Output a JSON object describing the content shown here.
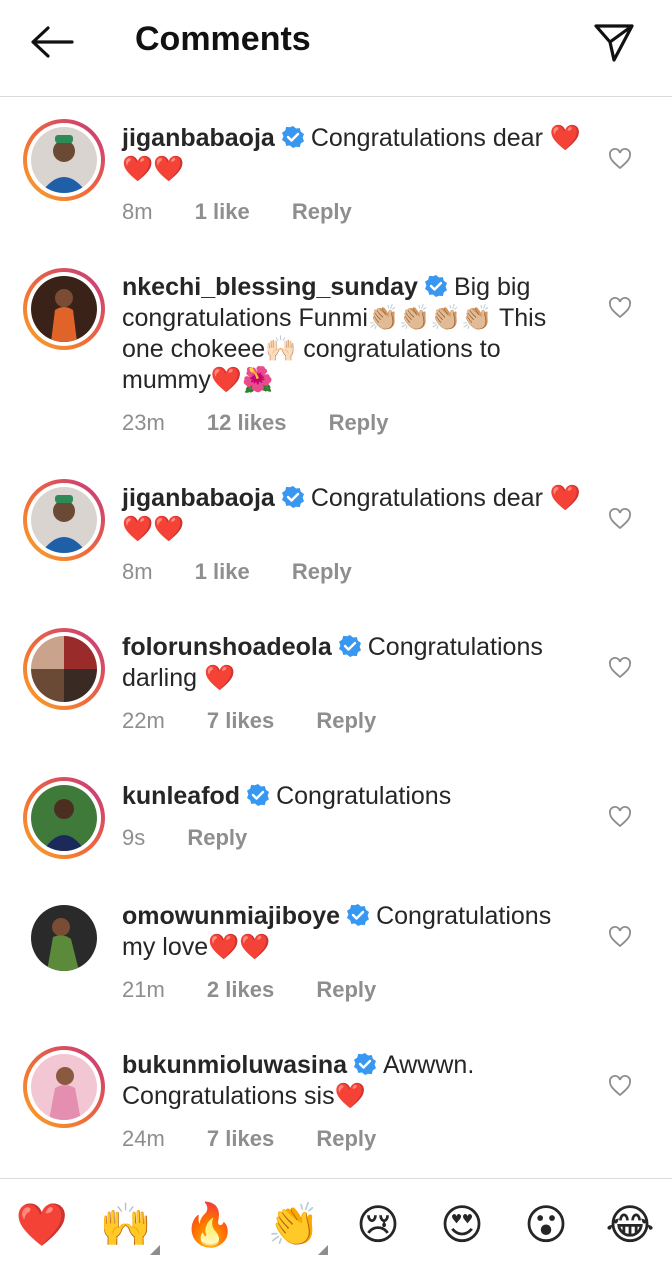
{
  "header": {
    "title": "Comments"
  },
  "comments": [
    {
      "username": "jiganbabaoja",
      "text": "Congratulations dear ❤️❤️❤️",
      "time": "8m",
      "likes": "1 like",
      "reply": "Reply",
      "avatar_ring": "gradient"
    },
    {
      "username": "nkechi_blessing_sunday",
      "text": "Big big congratulations Funmi👏🏼👏🏼👏🏼👏🏼 This one chokeee🙌🏻 congratulations to mummy❤️🌺",
      "time": "23m",
      "likes": "12 likes",
      "reply": "Reply",
      "avatar_ring": "gradient"
    },
    {
      "username": "jiganbabaoja",
      "text": "Congratulations dear ❤️❤️❤️",
      "time": "8m",
      "likes": "1 like",
      "reply": "Reply",
      "avatar_ring": "gradient"
    },
    {
      "username": "folorunshoadeola",
      "text": "Congratulations darling ❤️",
      "time": "22m",
      "likes": "7 likes",
      "reply": "Reply",
      "avatar_ring": "gradient"
    },
    {
      "username": "kunleafod",
      "text": "Congratulations",
      "time": "9s",
      "likes": "",
      "reply": "Reply",
      "avatar_ring": "gradient"
    },
    {
      "username": "omowunmiajiboye",
      "text": "Congratulations my love❤️❤️",
      "time": "21m",
      "likes": "2 likes",
      "reply": "Reply",
      "avatar_ring": "none"
    },
    {
      "username": "bukunmioluwasina",
      "text": "Awwwn. Congratulations sis❤️",
      "time": "24m",
      "likes": "7 likes",
      "reply": "Reply",
      "avatar_ring": "gradient"
    }
  ],
  "emoji_bar": [
    "❤️",
    "🙌",
    "🔥",
    "👏",
    "😢",
    "😍",
    "😮",
    "😂"
  ],
  "colors": {
    "verified": "#3897f0",
    "meta": "#8e8e8e",
    "ring_start": "#f9a825",
    "ring_end": "#c13584"
  }
}
